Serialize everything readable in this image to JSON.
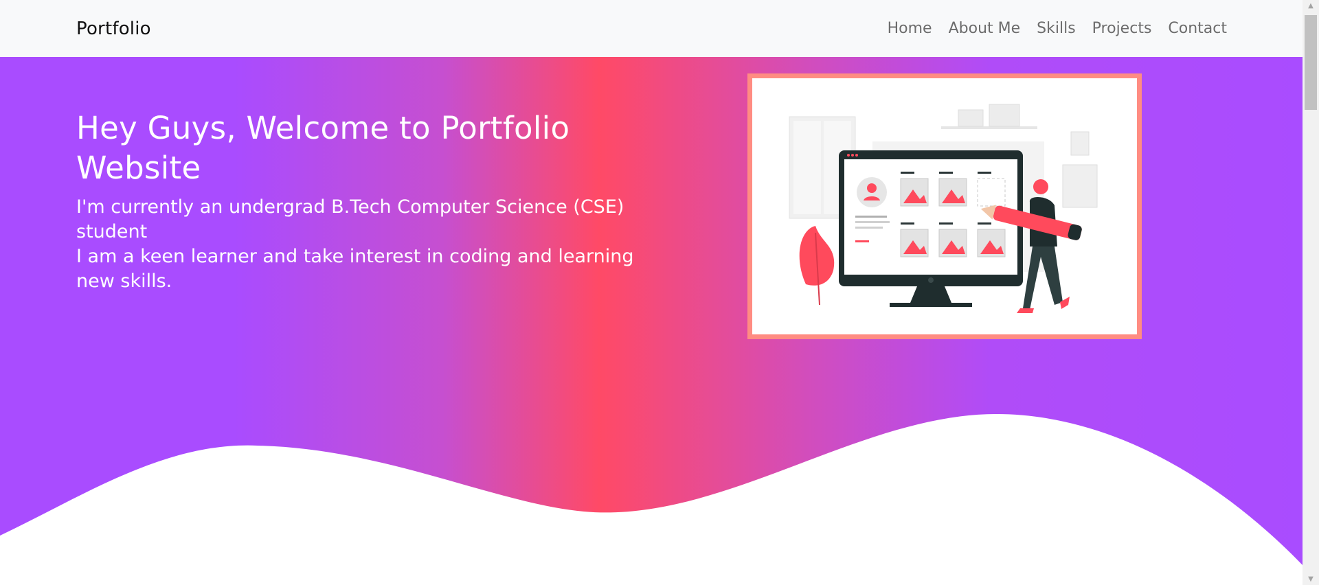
{
  "navbar": {
    "brand": "Portfolio",
    "links": [
      "Home",
      "About Me",
      "Skills",
      "Projects",
      "Contact"
    ]
  },
  "hero": {
    "title": "Hey Guys, Welcome to Portfolio Website",
    "line1": "I'm currently an undergrad B.Tech Computer Science (CSE) student",
    "line2": "I am a keen learner and take interest in coding and learning new skills.",
    "illustration": "person-with-pencil-computer-gallery-illustration"
  },
  "colors": {
    "purple": "#a94cff",
    "pink": "#ff4a66",
    "frame": "#ff8c82",
    "navbar_bg": "#f8f9fa"
  },
  "scrollbar": {
    "up_icon": "scroll-up-arrow-icon",
    "down_icon": "scroll-down-arrow-icon"
  }
}
